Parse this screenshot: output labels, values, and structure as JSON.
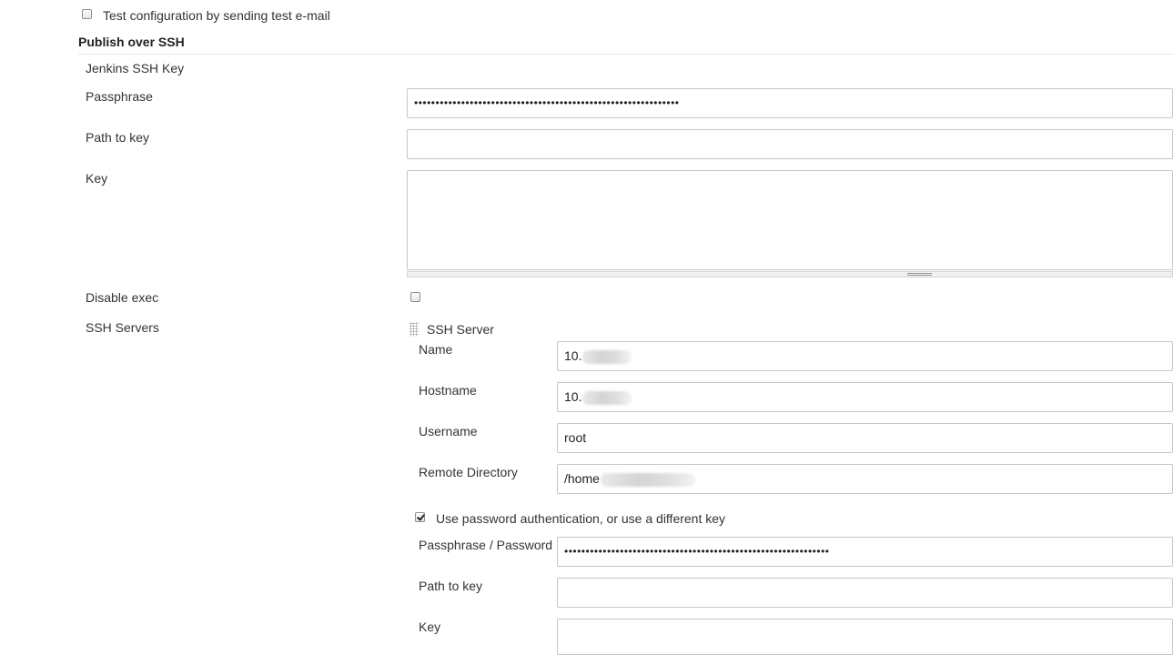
{
  "test_config": {
    "label": "Test configuration by sending test e-mail",
    "checked": false
  },
  "publish_ssh": {
    "title": "Publish over SSH",
    "jenkins_ssh_key": "Jenkins SSH Key",
    "passphrase_label": "Passphrase",
    "passphrase_value": "••••••••••••••••••••••••••••••••••••••••••••••••••••••••••••••",
    "path_to_key_label": "Path to key",
    "path_to_key_value": "",
    "key_label": "Key",
    "key_value": "",
    "disable_exec_label": "Disable exec",
    "disable_exec_checked": false,
    "ssh_servers_label": "SSH Servers"
  },
  "ssh_server": {
    "header": "SSH Server",
    "name_label": "Name",
    "name_value": "10.",
    "hostname_label": "Hostname",
    "hostname_value": "10.",
    "username_label": "Username",
    "username_value": "root",
    "remote_dir_label": "Remote Directory",
    "remote_dir_value": "/home",
    "use_password_label": "Use password authentication, or use a different key",
    "use_password_checked": true,
    "passphrase_password_label": "Passphrase / Password",
    "passphrase_password_value": "••••••••••••••••••••••••••••••••••••••••••••••••••••••••••••••",
    "path_to_key_label": "Path to key",
    "path_to_key_value": "",
    "key_label": "Key"
  }
}
